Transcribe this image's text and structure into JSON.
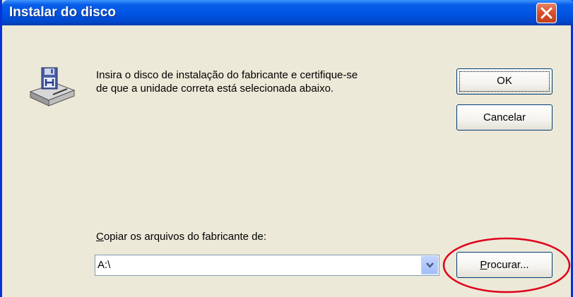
{
  "window": {
    "title": "Instalar do disco",
    "colors": {
      "titlebar": "#0055e5",
      "body": "#ece9d8",
      "close": "#d9512c",
      "annotation": "#e0001a"
    }
  },
  "icons": {
    "close": "close-x-icon",
    "app": "floppy-disk-drive-icon",
    "dropdown": "chevron-down-icon"
  },
  "message": {
    "line1": "Insira o disco de instalação do fabricante e certifique-se",
    "line2": "de que a unidade correta está selecionada abaixo."
  },
  "buttons": {
    "ok": "OK",
    "cancel": "Cancelar",
    "browse_mnemonic": "P",
    "browse_rest": "rocurar..."
  },
  "copy_from": {
    "label_mnemonic": "C",
    "label_rest": "opiar os arquivos do fabricante de:",
    "value": "A:\\"
  }
}
